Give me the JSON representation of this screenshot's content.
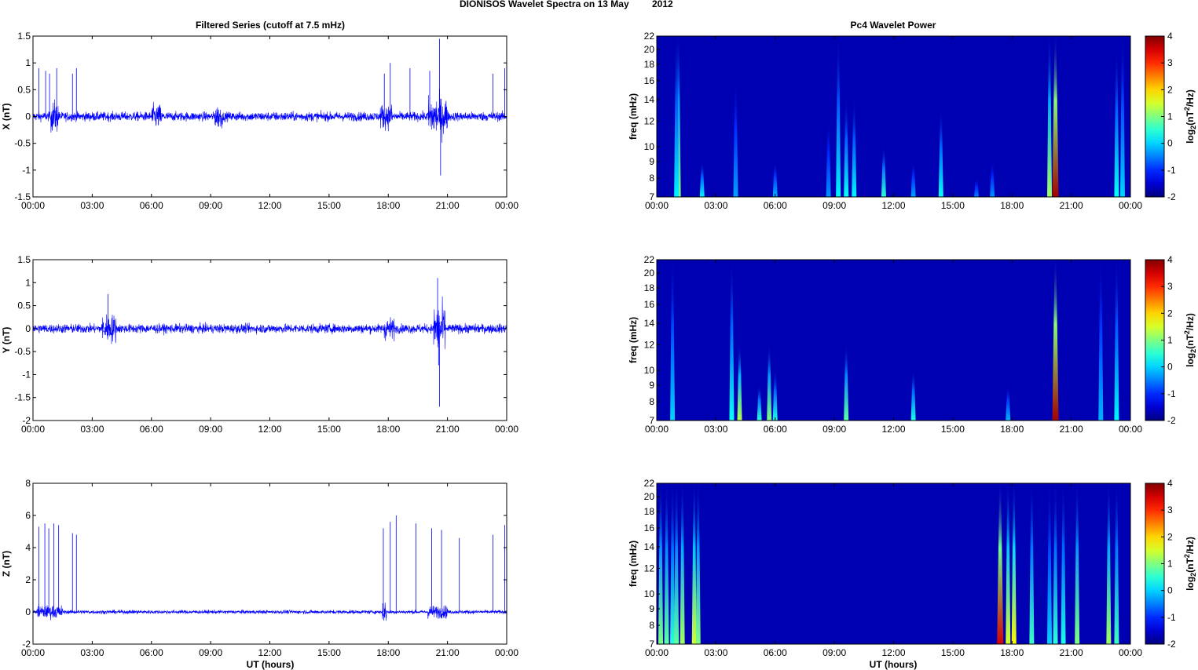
{
  "title_main": "DIONISOS Wavelet Spectra on 13 May",
  "title_year": "2012",
  "left_title": "Filtered Series (cutoff at 7.5 mHz)",
  "right_title": "Pc4 Wavelet Power",
  "chart_data": {
    "time_ticks": [
      "00:00",
      "03:00",
      "06:00",
      "09:00",
      "12:00",
      "15:00",
      "18:00",
      "21:00",
      "00:00"
    ],
    "xlabel": "UT (hours)",
    "xlim_hours": [
      0,
      24
    ],
    "series_panels": [
      {
        "type": "line",
        "ylabel": "X (nT)",
        "ylim": [
          -1.5,
          1.5
        ],
        "yticks": [
          -1.5,
          -1,
          -0.5,
          0,
          0.5,
          1,
          1.5
        ],
        "ytick_labels": [
          "-1.5",
          "-1",
          "-0.5",
          "0",
          "0.5",
          "1",
          "1.5"
        ],
        "noise": 0.06,
        "active": [
          [
            0.9,
            1.3,
            0.15
          ],
          [
            6,
            6.5,
            0.1
          ],
          [
            9.2,
            9.6,
            0.1
          ],
          [
            17.6,
            18.2,
            0.1
          ],
          [
            20,
            21,
            0.2
          ]
        ],
        "spikes": [
          [
            0.3,
            0.9
          ],
          [
            0.64,
            0.85
          ],
          [
            0.84,
            0.8
          ],
          [
            1.2,
            0.9
          ],
          [
            2.0,
            0.8
          ],
          [
            2.2,
            0.9
          ],
          [
            17.8,
            0.8
          ],
          [
            18.1,
            1.0
          ],
          [
            19.1,
            0.9
          ],
          [
            20.1,
            0.85
          ],
          [
            20.6,
            1.45
          ],
          [
            20.65,
            -1.1
          ],
          [
            23.3,
            0.8
          ],
          [
            23.9,
            0.9
          ]
        ]
      },
      {
        "type": "line",
        "ylabel": "Y (nT)",
        "ylim": [
          -2,
          1.5
        ],
        "yticks": [
          -2,
          -1.5,
          -1,
          -0.5,
          0,
          0.5,
          1,
          1.5
        ],
        "ytick_labels": [
          "-2",
          "-1.5",
          "-1",
          "-0.5",
          "0",
          "0.5",
          "1",
          "1.5"
        ],
        "noise": 0.07,
        "active": [
          [
            3.5,
            4.2,
            0.15
          ],
          [
            17.8,
            18.3,
            0.1
          ],
          [
            20.3,
            20.9,
            0.3
          ]
        ],
        "spikes": [
          [
            3.8,
            0.75
          ],
          [
            20.5,
            1.1
          ],
          [
            20.6,
            -1.7
          ],
          [
            20.55,
            -0.8
          ]
        ]
      },
      {
        "type": "line",
        "ylabel": "Z (nT)",
        "ylim": [
          -2,
          8
        ],
        "yticks": [
          -2,
          0,
          2,
          4,
          6,
          8
        ],
        "ytick_labels": [
          "-2",
          "0",
          "2",
          "4",
          "6",
          "8"
        ],
        "noise": 0.08,
        "active": [
          [
            0.2,
            1.5,
            0.2
          ],
          [
            17.7,
            17.9,
            0.4
          ],
          [
            20,
            21,
            0.2
          ]
        ],
        "spikes": [
          [
            0.3,
            5.3
          ],
          [
            0.6,
            5.5
          ],
          [
            0.8,
            5.2
          ],
          [
            1.05,
            5.5
          ],
          [
            1.3,
            5.4
          ],
          [
            2.0,
            4.9
          ],
          [
            2.2,
            4.8
          ],
          [
            17.75,
            5.2
          ],
          [
            18.1,
            5.6
          ],
          [
            18.4,
            6.0
          ],
          [
            19.4,
            5.5
          ],
          [
            20.2,
            5.2
          ],
          [
            20.7,
            5.1
          ],
          [
            21.6,
            4.6
          ],
          [
            23.3,
            4.8
          ],
          [
            23.9,
            5.4
          ]
        ]
      }
    ],
    "wavelet_panels": [
      {
        "type": "heatmap",
        "ylabel": "freq (mHz)",
        "freq_ticks": [
          7,
          8,
          9,
          10,
          12,
          14,
          16,
          18,
          20,
          22
        ],
        "colorbar_label": "log2(nT2/Hz)",
        "clim": [
          -2,
          4
        ],
        "cbar_ticks": [
          -2,
          -1,
          0,
          1,
          2,
          3,
          4
        ],
        "background": -1.7,
        "events": [
          [
            1.1,
            22,
            1.0
          ],
          [
            1.0,
            22,
            0.2
          ],
          [
            2.3,
            9,
            0.2
          ],
          [
            4.0,
            16,
            -0.3
          ],
          [
            6.0,
            9,
            -0.2
          ],
          [
            8.7,
            12,
            -0.4
          ],
          [
            9.2,
            22,
            0.2
          ],
          [
            9.6,
            14,
            0.3
          ],
          [
            10.0,
            14,
            0.2
          ],
          [
            11.5,
            10,
            0.5
          ],
          [
            13.0,
            9,
            -0.3
          ],
          [
            14.4,
            13,
            0.3
          ],
          [
            16.2,
            8,
            -0.5
          ],
          [
            17.0,
            9,
            -0.4
          ],
          [
            19.9,
            22,
            1.2
          ],
          [
            20.2,
            22,
            3.8
          ],
          [
            23.3,
            20,
            0.3
          ],
          [
            23.6,
            22,
            0.0
          ]
        ]
      },
      {
        "type": "heatmap",
        "ylabel": "freq (mHz)",
        "freq_ticks": [
          7,
          8,
          9,
          10,
          12,
          14,
          16,
          18,
          20,
          22
        ],
        "colorbar_label": "log2(nT2/Hz)",
        "clim": [
          -2,
          4
        ],
        "cbar_ticks": [
          -2,
          -1,
          0,
          1,
          2,
          3,
          4
        ],
        "background": -1.7,
        "events": [
          [
            0.8,
            22,
            0.0
          ],
          [
            3.8,
            22,
            0.3
          ],
          [
            4.2,
            12,
            1.3
          ],
          [
            5.2,
            9,
            0.5
          ],
          [
            5.7,
            12,
            1.0
          ],
          [
            6.0,
            10,
            0.4
          ],
          [
            9.6,
            12,
            0.8
          ],
          [
            13.0,
            10,
            0.4
          ],
          [
            17.8,
            9,
            -0.2
          ],
          [
            20.2,
            22,
            3.8
          ],
          [
            22.5,
            22,
            -0.2
          ],
          [
            23.3,
            22,
            0.2
          ]
        ]
      },
      {
        "type": "heatmap",
        "ylabel": "freq (mHz)",
        "freq_ticks": [
          7,
          8,
          9,
          10,
          12,
          14,
          16,
          18,
          20,
          22
        ],
        "colorbar_label": "log2(nT2/Hz)",
        "clim": [
          -2,
          4
        ],
        "cbar_ticks": [
          -2,
          -1,
          0,
          1,
          2,
          3,
          4
        ],
        "background": -1.7,
        "events": [
          [
            0.2,
            22,
            1.0
          ],
          [
            0.5,
            22,
            0.8
          ],
          [
            0.8,
            22,
            0.5
          ],
          [
            1.0,
            22,
            0.8
          ],
          [
            1.3,
            22,
            1.2
          ],
          [
            1.9,
            22,
            1.5
          ],
          [
            2.1,
            22,
            1.0
          ],
          [
            17.4,
            22,
            3.5
          ],
          [
            17.8,
            22,
            1.5
          ],
          [
            18.1,
            22,
            1.8
          ],
          [
            19.0,
            22,
            0.6
          ],
          [
            19.9,
            22,
            0.0
          ],
          [
            20.2,
            22,
            0.5
          ],
          [
            20.6,
            22,
            0.4
          ],
          [
            21.3,
            22,
            1.0
          ],
          [
            22.9,
            22,
            1.2
          ],
          [
            23.3,
            22,
            0.6
          ]
        ]
      }
    ]
  }
}
